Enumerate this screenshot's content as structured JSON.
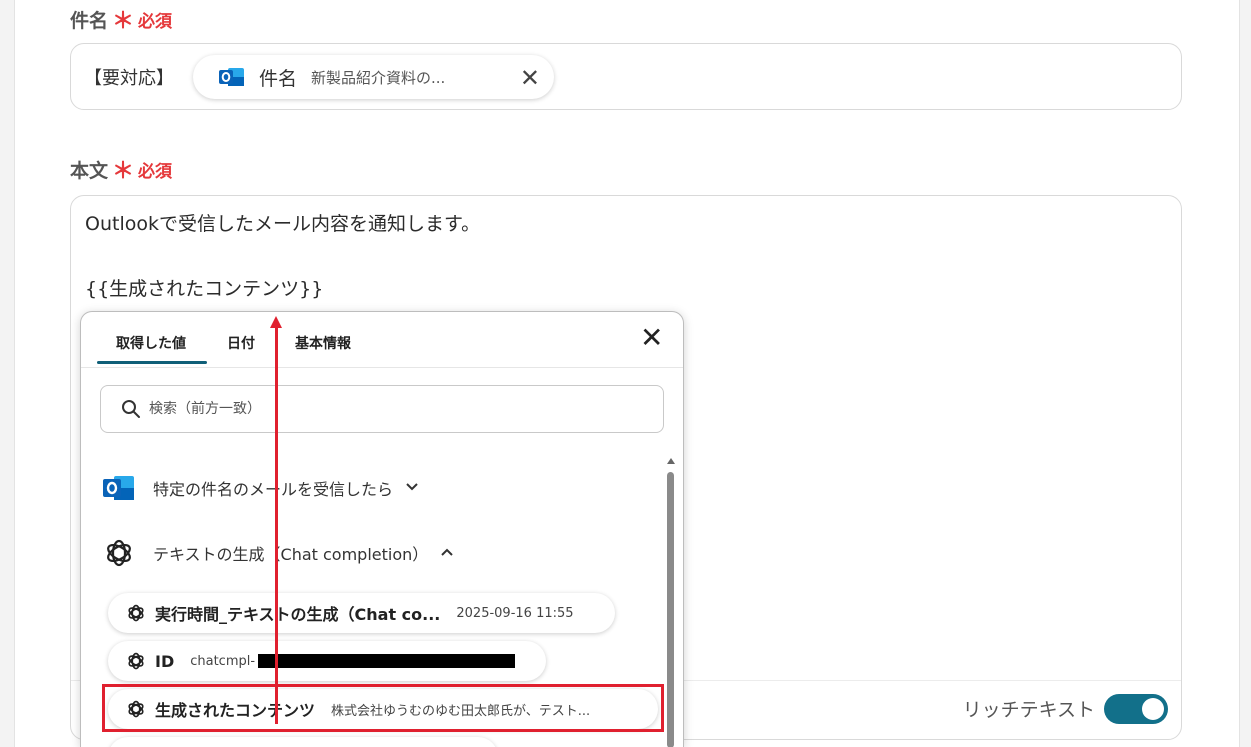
{
  "subject_field": {
    "label": "件名",
    "required_star": "＊",
    "required_text": "必須",
    "prefix": "【要対応】",
    "chip": {
      "icon": "outlook-icon",
      "name": "件名",
      "value": "新製品紹介資料の...",
      "remove": "✕"
    }
  },
  "body_field": {
    "label": "本文",
    "required_star": "＊",
    "required_text": "必須",
    "lines": [
      "Outlookで受信したメール内容を通知します。",
      "{{生成されたコンテンツ}}"
    ],
    "rich_text_label": "リッチテキスト",
    "rich_text_enabled": true
  },
  "popup": {
    "tabs": [
      "取得した値",
      "日付",
      "基本情報"
    ],
    "active_tab": "取得した値",
    "close": "✕",
    "search_placeholder": "検索（前方一致）",
    "groups": [
      {
        "icon": "outlook-icon",
        "label": "特定の件名のメールを受信したら",
        "expanded": false
      },
      {
        "icon": "openai-icon",
        "label": "テキストの生成（Chat completion）",
        "expanded": true
      }
    ],
    "items": [
      {
        "icon": "openai-icon",
        "name": "実行時間_テキストの生成（Chat co...",
        "value": "2025-09-16 11:55"
      },
      {
        "icon": "openai-icon",
        "name": "ID",
        "value": "chatcmpl-"
      },
      {
        "icon": "openai-icon",
        "name": "生成されたコンテンツ",
        "value": "株式会社ゆうむのゆむ田太郎氏が、テスト..."
      }
    ]
  },
  "colors": {
    "required": "#e5383b",
    "accent": "#12708a",
    "annotation": "#e0202f"
  }
}
